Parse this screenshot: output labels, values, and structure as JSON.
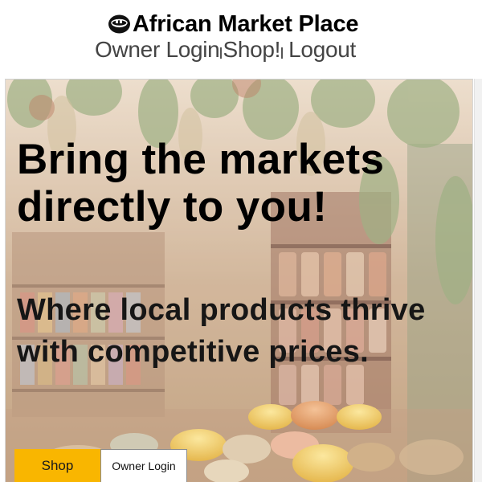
{
  "header": {
    "brand_title": "African Market Place",
    "logo_icon": "market-basket-icon"
  },
  "nav": {
    "owner_login": "Owner Login",
    "shop": "Shop!",
    "logout": "Logout"
  },
  "hero": {
    "headline": "Bring the markets directly to you!",
    "subheadline": "Where local products thrive with competitive prices.",
    "background_image": "market-spices-photo",
    "shop_button": "Shop",
    "owner_login_button": "Owner Login"
  },
  "colors": {
    "shop_button": "#f9b600",
    "text": "#000000",
    "nav_text": "#444444"
  }
}
